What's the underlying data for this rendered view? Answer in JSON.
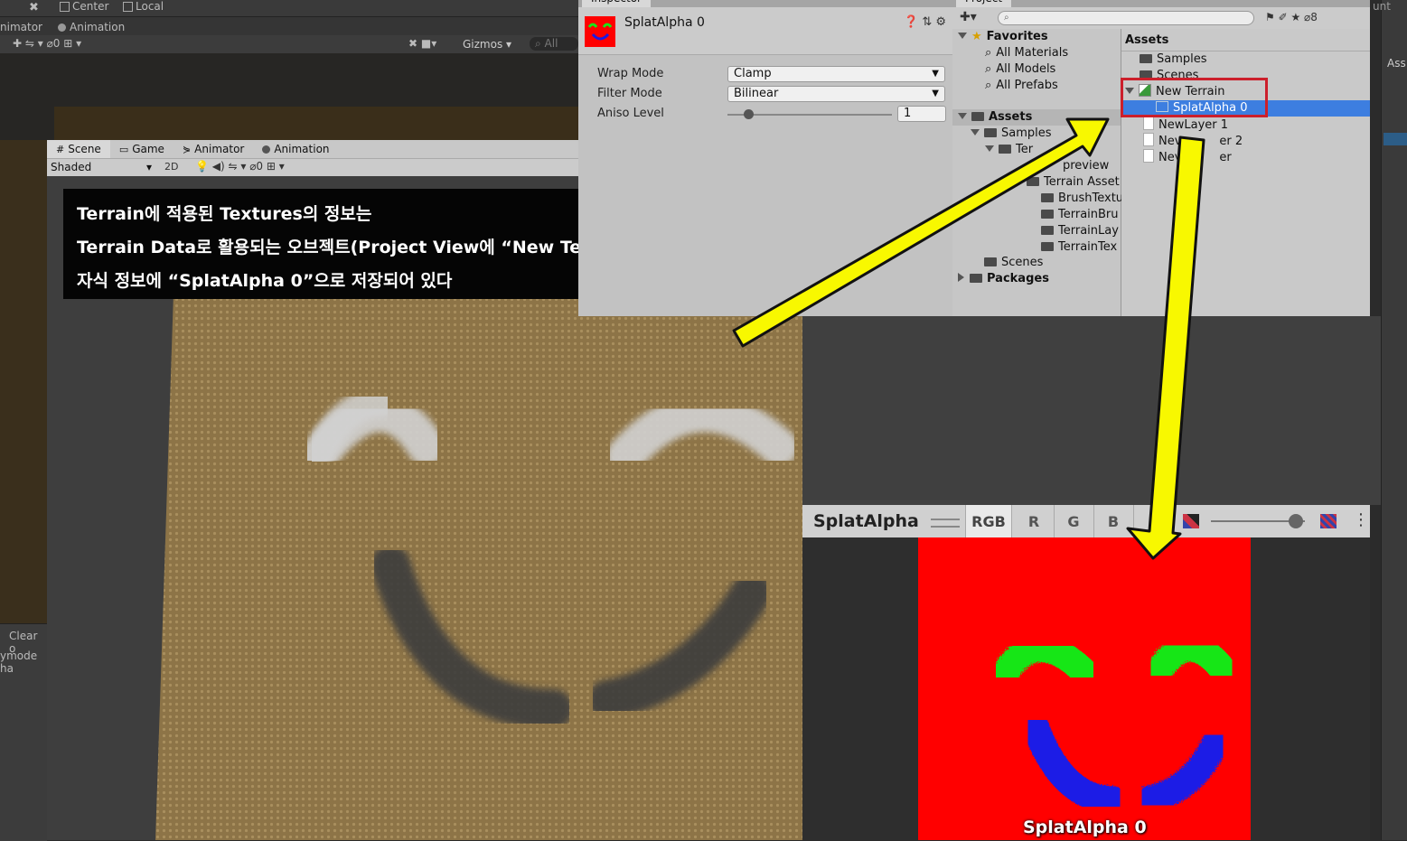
{
  "top_toolbar": {
    "pivot_center": "Center",
    "pivot_local": "Local"
  },
  "animator_bar": {
    "left_tab": "nimator",
    "right_tab": "Animation"
  },
  "scene_toolbar": {
    "gizmos": "Gizmos",
    "search_placeholder": "All",
    "hidden_count": "0"
  },
  "scene_tabs": [
    {
      "label": "Scene",
      "icon": "grid-icon"
    },
    {
      "label": "Game",
      "icon": "gamepad-icon"
    },
    {
      "label": "Animator",
      "icon": "animator-icon"
    },
    {
      "label": "Animation",
      "icon": "clock-icon"
    }
  ],
  "scene_view": {
    "shading_mode": "Shaded",
    "mode_2d": "2D",
    "hidden_count": "0"
  },
  "console": {
    "clear_label": "Clear o",
    "text": "ymode ha"
  },
  "caption": {
    "line1": "Terrain에 적용된 Textures의 정보는",
    "line2": "Terrain Data로 활용되는 오브젝트(Project View에 “New Terrain”)의",
    "line3": "자식 정보에 “SplatAlpha 0”으로 저장되어 있다"
  },
  "inspector": {
    "tab": "Inspector",
    "asset_name": "SplatAlpha 0",
    "props": [
      {
        "label": "Wrap Mode",
        "value": "Clamp"
      },
      {
        "label": "Filter Mode",
        "value": "Bilinear"
      },
      {
        "label": "Aniso Level",
        "value": "1"
      }
    ],
    "aniso_slider": 0.1
  },
  "project": {
    "tab": "Project",
    "hidden_count": "8",
    "favorites": {
      "title": "Favorites",
      "items": [
        "All Materials",
        "All Models",
        "All Prefabs"
      ]
    },
    "tree": {
      "assets": "Assets",
      "samples": "Samples",
      "ter": "Ter",
      "preview": "preview",
      "terrain_assets": "Terrain Asset",
      "sub": [
        "BrushTextu",
        "TerrainBru",
        "TerrainLay",
        "TerrainTex"
      ],
      "scenes": "Scenes",
      "packages": "Packages"
    },
    "assets_panel": {
      "title": "Assets",
      "items": [
        "Samples",
        "Scenes",
        "New Terrain",
        "SplatAlpha 0",
        "NewLayer 1",
        "Nev",
        "er 2",
        "Nev",
        "er"
      ]
    }
  },
  "preview": {
    "title": "SplatAlpha",
    "channels": [
      "RGB",
      "R",
      "G",
      "B"
    ],
    "caption": "SplatAlpha 0",
    "mip_slider": 0.9
  },
  "right_edge": {
    "label": "Ass",
    "unt": "unt"
  },
  "colors": {
    "highlight": "#3d7ee0",
    "red_box": "#cc1f2b",
    "arrow": "#f8f800",
    "splat_red": "#ff0000",
    "splat_green": "#19e619",
    "splat_blue": "#1a1ae6"
  }
}
